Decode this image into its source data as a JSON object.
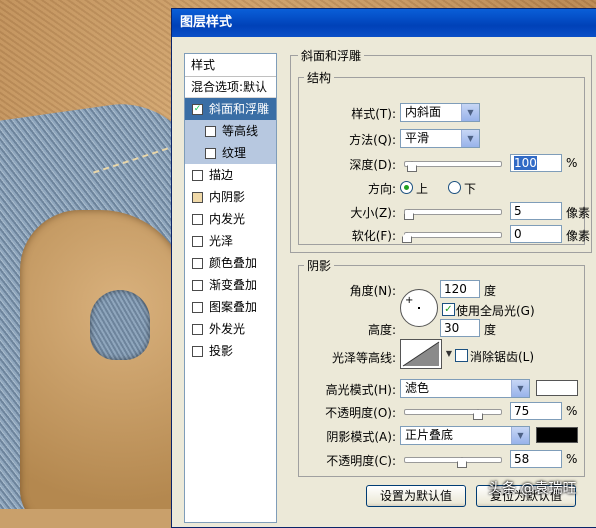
{
  "window": {
    "title": "图层样式"
  },
  "left_panel": {
    "header": "样式",
    "blend_options": "混合选项:默认",
    "items": [
      {
        "label": "斜面和浮雕",
        "checked": true,
        "selected": true
      },
      {
        "label": "等高线",
        "checked": false,
        "sub": true
      },
      {
        "label": "纹理",
        "checked": false,
        "sub": true
      },
      {
        "label": "描边",
        "checked": false
      },
      {
        "label": "内阴影",
        "checked": false
      },
      {
        "label": "内发光",
        "checked": false
      },
      {
        "label": "光泽",
        "checked": false
      },
      {
        "label": "颜色叠加",
        "checked": false
      },
      {
        "label": "渐变叠加",
        "checked": false
      },
      {
        "label": "图案叠加",
        "checked": false
      },
      {
        "label": "外发光",
        "checked": false
      },
      {
        "label": "投影",
        "checked": false
      }
    ]
  },
  "bevel": {
    "section_title": "斜面和浮雕",
    "structure_title": "结构",
    "style_label": "样式(T):",
    "style_value": "内斜面",
    "technique_label": "方法(Q):",
    "technique_value": "平滑",
    "depth_label": "深度(D):",
    "depth_value": "100",
    "depth_unit": "%",
    "direction_label": "方向:",
    "direction_up": "上",
    "direction_down": "下",
    "size_label": "大小(Z):",
    "size_value": "5",
    "size_unit": "像素",
    "soften_label": "软化(F):",
    "soften_value": "0",
    "soften_unit": "像素"
  },
  "shading": {
    "title": "阴影",
    "angle_label": "角度(N):",
    "angle_value": "120",
    "angle_unit": "度",
    "global_light_label": "使用全局光(G)",
    "altitude_label": "高度:",
    "altitude_value": "30",
    "altitude_unit": "度",
    "gloss_contour_label": "光泽等高线:",
    "anti_alias_label": "消除锯齿(L)",
    "highlight_mode_label": "高光模式(H):",
    "highlight_mode_value": "滤色",
    "highlight_color": "#ffffff",
    "highlight_opacity_label": "不透明度(O):",
    "highlight_opacity_value": "75",
    "highlight_opacity_unit": "%",
    "shadow_mode_label": "阴影模式(A):",
    "shadow_mode_value": "正片叠底",
    "shadow_color": "#000000",
    "shadow_opacity_label": "不透明度(C):",
    "shadow_opacity_value": "58",
    "shadow_opacity_unit": "%"
  },
  "buttons": {
    "make_default": "设置为默认值",
    "reset_default": "复位为默认值"
  },
  "watermark": "头条 @袁瑞旺"
}
